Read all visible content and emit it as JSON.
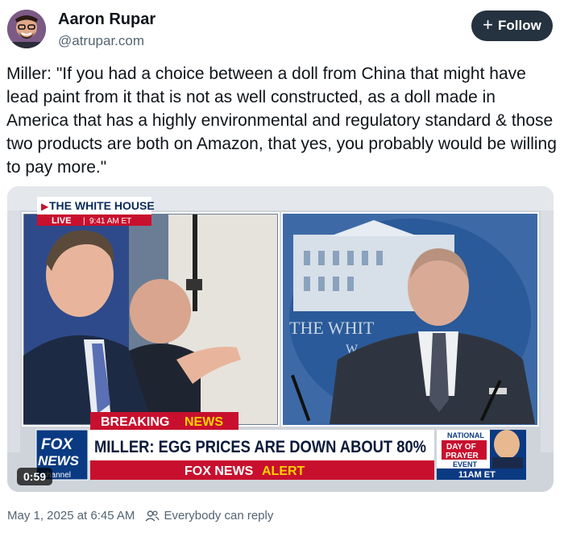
{
  "author": {
    "name": "Aaron Rupar",
    "handle": "@atrupar.com"
  },
  "follow_button": {
    "label": "Follow",
    "icon": "plus-icon"
  },
  "post": {
    "text": "Miller: \"If you had a choice between a doll from China that might have lead paint from it that is not as well constructed, as a doll made in America that has a highly environmental and regulatory standard & those two products are both on Amazon, that yes, you probably would be willing to pay more.\""
  },
  "video": {
    "duration": "0:59",
    "bug_title": "THE WHITE HOUSE",
    "bug_live": "LIVE",
    "bug_time": "9:41 AM ET",
    "podium_text": "THE WHIT",
    "podium_text2": "W",
    "breaking_label": "BREAKING",
    "breaking_label2": "NEWS",
    "headline": "MILLER: EGG PRICES ARE DOWN ABOUT 80%",
    "alert_label": "FOX NEWS",
    "alert_label2": "ALERT",
    "logo_top": "FOX",
    "logo_bottom": "NEWS",
    "logo_channel": "channel",
    "promo_line1": "NATIONAL",
    "promo_line2": "DAY OF",
    "promo_line3": "PRAYER",
    "promo_line4": "EVENT",
    "promo_time": "11AM ET"
  },
  "footer": {
    "timestamp": "May 1, 2025 at 6:45 AM",
    "reply_setting": "Everybody can reply",
    "reply_icon": "people-icon"
  },
  "colors": {
    "follow_bg": "#25323f",
    "fox_red": "#c8102e",
    "fox_blue": "#0a3a82",
    "alert_yellow": "#ffd200"
  }
}
